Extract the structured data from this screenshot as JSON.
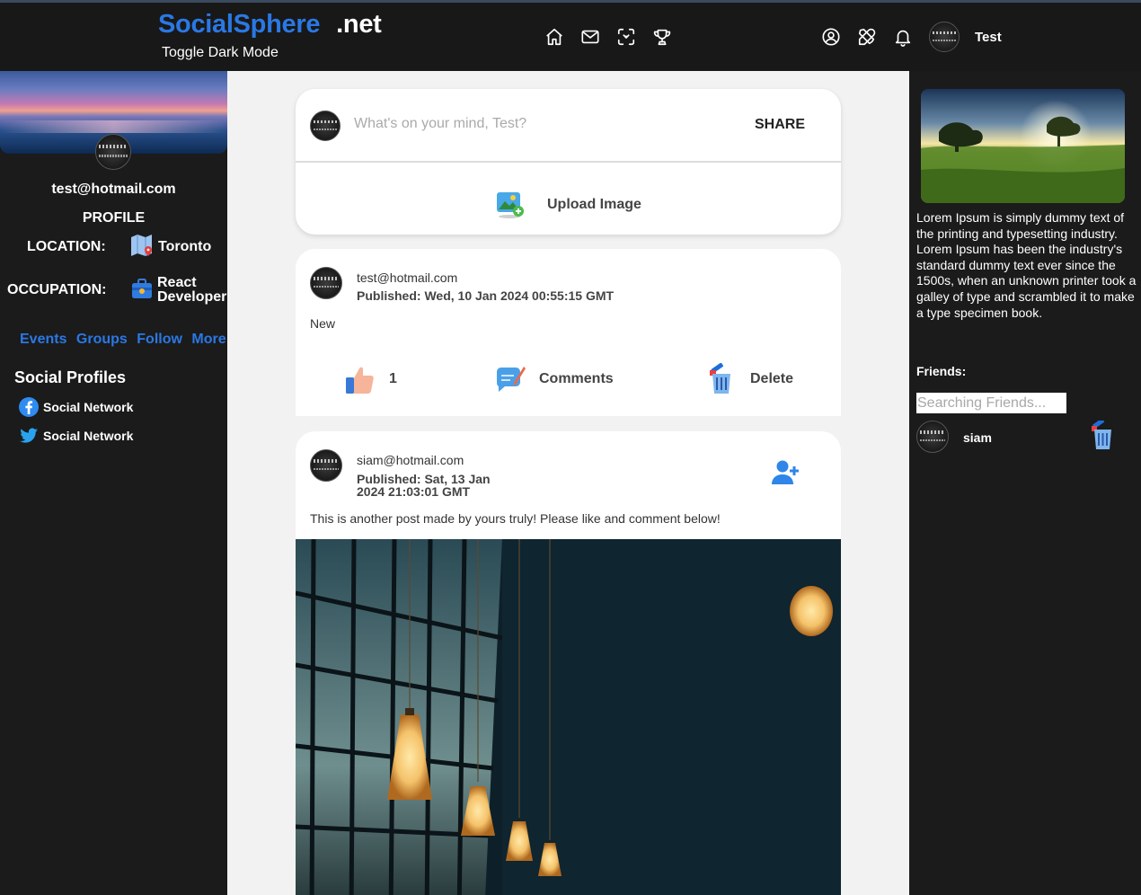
{
  "header": {
    "brand_main": "SocialSphere",
    "brand_suffix": ".net",
    "toggle_label": "Toggle Dark Mode",
    "nav_icons": [
      "home-icon",
      "mail-icon",
      "focus-icon",
      "trophy-icon"
    ],
    "right_icons": [
      "user-circle-icon",
      "tools-icon",
      "bell-icon"
    ],
    "user_name": "Test"
  },
  "sidebar": {
    "email": "test@hotmail.com",
    "profile_heading": "PROFILE",
    "location_label": "LOCATION:",
    "location_value": "Toronto",
    "occupation_label": "OCCUPATION:",
    "occupation_line1": "React",
    "occupation_line2": "Developer",
    "links": [
      "Events",
      "Groups",
      "Follow",
      "More"
    ],
    "social_heading": "Social Profiles",
    "social_items": [
      {
        "label": "Social Network",
        "icon": "facebook-icon"
      },
      {
        "label": "Social Network",
        "icon": "twitter-icon"
      }
    ]
  },
  "composer": {
    "placeholder": "What's on your mind, Test?",
    "share_label": "SHARE",
    "upload_label": "Upload Image"
  },
  "posts": [
    {
      "author": "test@hotmail.com",
      "published": "Published: Wed, 10 Jan 2024 00:55:15 GMT",
      "text": "New",
      "likes": "1",
      "comments_label": "Comments",
      "delete_label": "Delete"
    },
    {
      "author": "siam@hotmail.com",
      "published_line1": "Published: Sat, 13 Jan",
      "published_line2": "2024 21:03:01 GMT",
      "text": "This is another post made by yours truly! Please like and comment below!"
    }
  ],
  "right_panel": {
    "lorem": "Lorem Ipsum is simply dummy text of the printing and typesetting industry. Lorem Ipsum has been the industry's standard dummy text ever since the 1500s, when an unknown printer took a galley of type and scrambled it to make a type specimen book.",
    "friends_heading": "Friends:",
    "search_placeholder": "Searching Friends...",
    "friends": [
      {
        "name": "siam"
      }
    ]
  },
  "colors": {
    "brand_blue": "#2a78e4",
    "dark_bg": "#1b1b1b",
    "feed_bg": "#f2f2f2"
  }
}
